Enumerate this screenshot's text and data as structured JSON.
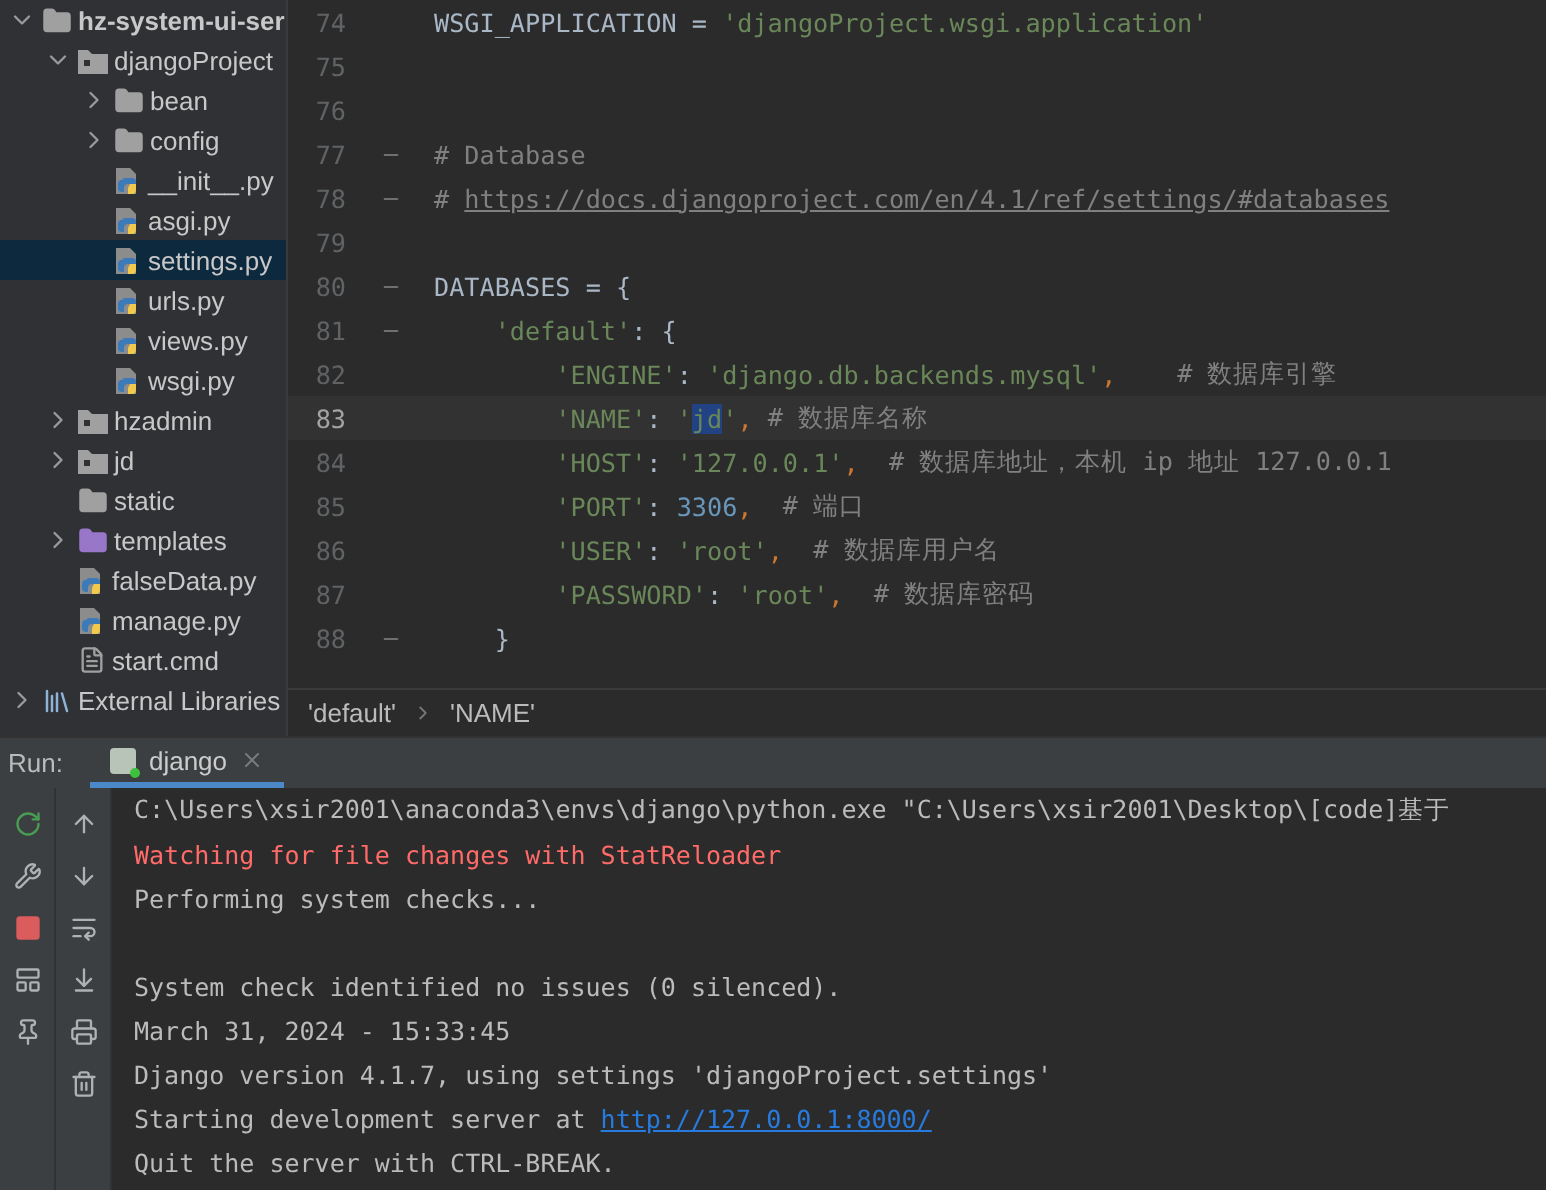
{
  "project_tree": [
    {
      "label": "hz-system-ui-ser",
      "kind": "folder",
      "expanded": true,
      "selected": false,
      "children": [
        {
          "label": "djangoProject",
          "kind": "package",
          "expanded": true,
          "selected": false,
          "children": [
            {
              "label": "bean",
              "kind": "folder",
              "expanded": false,
              "selected": false
            },
            {
              "label": "config",
              "kind": "folder",
              "expanded": false,
              "selected": false
            },
            {
              "label": "__init__.py",
              "kind": "python",
              "selected": false
            },
            {
              "label": "asgi.py",
              "kind": "python",
              "selected": false
            },
            {
              "label": "settings.py",
              "kind": "python",
              "selected": true
            },
            {
              "label": "urls.py",
              "kind": "python",
              "selected": false
            },
            {
              "label": "views.py",
              "kind": "python",
              "selected": false
            },
            {
              "label": "wsgi.py",
              "kind": "python",
              "selected": false
            }
          ]
        },
        {
          "label": "hzadmin",
          "kind": "package",
          "expanded": false,
          "selected": false
        },
        {
          "label": "jd",
          "kind": "package",
          "expanded": false,
          "selected": false
        },
        {
          "label": "static",
          "kind": "folder",
          "selected": false
        },
        {
          "label": "templates",
          "kind": "templates",
          "expanded": false,
          "selected": false
        },
        {
          "label": "falseData.py",
          "kind": "python",
          "selected": false
        },
        {
          "label": "manage.py",
          "kind": "python",
          "selected": false
        },
        {
          "label": "start.cmd",
          "kind": "file",
          "selected": false
        }
      ]
    },
    {
      "label": "External Libraries",
      "kind": "library",
      "expanded": false,
      "selected": false
    }
  ],
  "editor": {
    "lines": [
      {
        "number": "74",
        "current": false,
        "tokens": [
          {
            "kind": "plain",
            "text": "WSGI_APPLICATION = "
          },
          {
            "kind": "string",
            "text": "'djangoProject.wsgi.application'"
          }
        ]
      },
      {
        "number": "75",
        "current": false
      },
      {
        "number": "76",
        "current": false
      },
      {
        "number": "77",
        "current": false,
        "fold": true,
        "tokens": [
          {
            "kind": "comment",
            "text": "# Database"
          }
        ]
      },
      {
        "number": "78",
        "current": false,
        "fold": true,
        "tokens": [
          {
            "kind": "comment",
            "text": "# "
          },
          {
            "kind": "link",
            "text": "https://docs.djangoproject.com/en/4.1/ref/settings/#databases"
          }
        ]
      },
      {
        "number": "79",
        "current": false
      },
      {
        "number": "80",
        "current": false,
        "fold": true,
        "tokens": [
          {
            "kind": "plain",
            "text": "DATABASES = {"
          }
        ]
      },
      {
        "number": "81",
        "current": false,
        "fold": true,
        "tokens": [
          {
            "kind": "string",
            "text": "    'default'"
          },
          {
            "kind": "plain",
            "text": ": {"
          }
        ]
      },
      {
        "number": "82",
        "current": false,
        "tokens": [
          {
            "kind": "string",
            "text": "        'ENGINE'"
          },
          {
            "kind": "plain",
            "text": ": "
          },
          {
            "kind": "string",
            "text": "'django.db.backends.mysql'"
          },
          {
            "kind": "punct",
            "text": ","
          },
          {
            "kind": "comment",
            "text": "    # 数据库引擎"
          }
        ]
      },
      {
        "number": "83",
        "current": true,
        "tokens": [
          {
            "kind": "string",
            "text": "        'NAME'"
          },
          {
            "kind": "plain",
            "text": ": "
          },
          {
            "kind": "string",
            "text": "'"
          },
          {
            "kind": "string",
            "text": "jd",
            "selected": true
          },
          {
            "kind": "string",
            "text": "'"
          },
          {
            "kind": "punct",
            "text": ","
          },
          {
            "kind": "comment",
            "text": " # 数据库名称"
          }
        ]
      },
      {
        "number": "84",
        "current": false,
        "tokens": [
          {
            "kind": "string",
            "text": "        'HOST'"
          },
          {
            "kind": "plain",
            "text": ": "
          },
          {
            "kind": "string",
            "text": "'127.0.0.1'"
          },
          {
            "kind": "punct",
            "text": ","
          },
          {
            "kind": "comment",
            "text": "  # 数据库地址，本机 ip 地址 127.0.0.1"
          }
        ]
      },
      {
        "number": "85",
        "current": false,
        "tokens": [
          {
            "kind": "string",
            "text": "        'PORT'"
          },
          {
            "kind": "plain",
            "text": ": "
          },
          {
            "kind": "number",
            "text": "3306"
          },
          {
            "kind": "punct",
            "text": ","
          },
          {
            "kind": "comment",
            "text": "  # 端口"
          }
        ]
      },
      {
        "number": "86",
        "current": false,
        "tokens": [
          {
            "kind": "string",
            "text": "        'USER'"
          },
          {
            "kind": "plain",
            "text": ": "
          },
          {
            "kind": "string",
            "text": "'root'"
          },
          {
            "kind": "punct",
            "text": ","
          },
          {
            "kind": "comment",
            "text": "  # 数据库用户名"
          }
        ]
      },
      {
        "number": "87",
        "current": false,
        "tokens": [
          {
            "kind": "string",
            "text": "        'PASSWORD'"
          },
          {
            "kind": "plain",
            "text": ": "
          },
          {
            "kind": "string",
            "text": "'root'"
          },
          {
            "kind": "punct",
            "text": ","
          },
          {
            "kind": "comment",
            "text": "  # 数据库密码"
          }
        ]
      },
      {
        "number": "88",
        "current": false,
        "fold": true,
        "tokens": [
          {
            "kind": "plain",
            "text": "    }"
          }
        ]
      }
    ],
    "breadcrumbs": [
      "'default'",
      "'NAME'"
    ]
  },
  "run_panel": {
    "label": "Run:",
    "tabs": [
      {
        "label": "django",
        "selected": true
      }
    ],
    "console": [
      {
        "kind": "normal",
        "segments": [
          {
            "kind": "text",
            "text": "C:\\Users\\xsir2001\\anaconda3\\envs\\django\\python.exe \"C:\\Users\\xsir2001\\Desktop\\[code]基于"
          }
        ]
      },
      {
        "kind": "error",
        "segments": [
          {
            "kind": "text",
            "text": "Watching for file changes with StatReloader"
          }
        ]
      },
      {
        "kind": "normal",
        "segments": [
          {
            "kind": "text",
            "text": "Performing system checks..."
          }
        ]
      },
      {
        "kind": "normal"
      },
      {
        "kind": "normal",
        "segments": [
          {
            "kind": "text",
            "text": "System check identified no issues (0 silenced)."
          }
        ]
      },
      {
        "kind": "normal",
        "segments": [
          {
            "kind": "text",
            "text": "March 31, 2024 - 15:33:45"
          }
        ]
      },
      {
        "kind": "normal",
        "segments": [
          {
            "kind": "text",
            "text": "Django version 4.1.7, using settings 'djangoProject.settings'"
          }
        ]
      },
      {
        "kind": "normal",
        "segments": [
          {
            "kind": "text",
            "text": "Starting development server at "
          },
          {
            "kind": "link",
            "text": "http://127.0.0.1:8000/"
          }
        ]
      },
      {
        "kind": "normal",
        "segments": [
          {
            "kind": "text",
            "text": "Quit the server with CTRL-BREAK."
          }
        ]
      }
    ]
  }
}
